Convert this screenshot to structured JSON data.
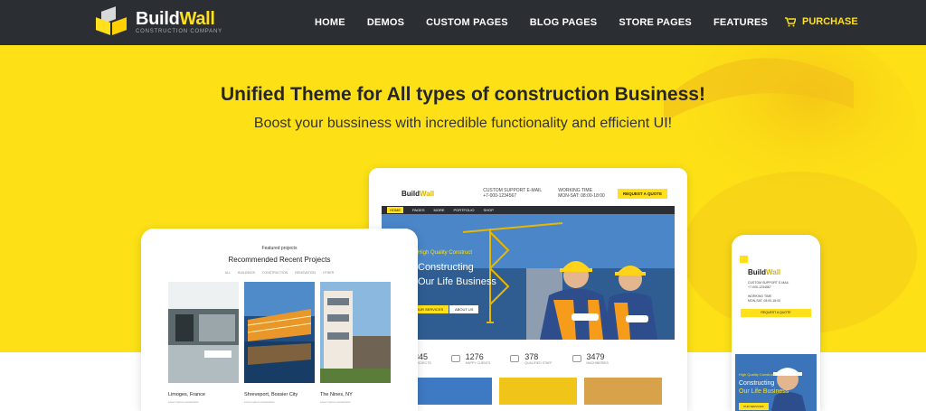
{
  "nav": {
    "logo_part1": "Build",
    "logo_part2": "Wall",
    "logo_sub": "CONSTRUCTION COMPANY",
    "items": [
      "HOME",
      "DEMOS",
      "CUSTOM PAGES",
      "BLOG PAGES",
      "STORE PAGES",
      "FEATURES"
    ],
    "purchase": "PURCHASE"
  },
  "hero": {
    "headline": "Unified Theme for All types of construction Business!",
    "subline": "Boost your bussiness with incredible functionality and efficient UI!"
  },
  "laptop": {
    "logo_part1": "Build",
    "logo_part2": "Wall",
    "phone_label": "CUSTOM SUPPORT E-MAIL",
    "phone": "+7-000-1234567",
    "hours_label": "WORKING TIME",
    "hours": "MON-SAT: 08:00-18:00",
    "quote_btn": "REQUEST A QUOTE",
    "menu": [
      "HOME",
      "PAGES",
      "MORE",
      "PORTFOLIO",
      "SHOP"
    ],
    "tag": "High Quality Construct",
    "title1a": "Constructing",
    "title2a": "Our Life Business",
    "btn1": "OUR SERVICES",
    "btn2": "ABOUT US",
    "stats": [
      {
        "num": "345",
        "label": "PROJECTS"
      },
      {
        "num": "1276",
        "label": "HAPPY CLIENTS"
      },
      {
        "num": "378",
        "label": "QUALIFIED STAFF"
      },
      {
        "num": "3479",
        "label": "MACHINERIES"
      }
    ]
  },
  "tablet": {
    "small": "Featured projects",
    "title": "Recommended Recent Projects",
    "filters": [
      "ALL",
      "BUILDINGS",
      "CONSTRUCTION",
      "RENOVATION",
      "OTHER"
    ],
    "cards": [
      {
        "name": "Limoges, France",
        "meta": "Lorem ipsum consectetur"
      },
      {
        "name": "Shreveport, Bossier City",
        "meta": "Lorem ipsum consectetur"
      },
      {
        "name": "The Nines, NY",
        "meta": "Lorem ipsum consectetur"
      }
    ]
  },
  "phone": {
    "logo_part1": "Build",
    "logo_part2": "Wall",
    "phone_label": "CUSTOM SUPPORT E-MAIL",
    "phone": "+7-000-1234567",
    "hours_label": "WORKING TIME",
    "hours": "MON-SAT: 08:00-18:00",
    "btn": "REQUEST A QUOTE",
    "tag": "High Quality Construct",
    "title1": "Constructing",
    "title2": "Our Life Business",
    "cta": "OUR SERVICES"
  },
  "colors": {
    "brand_yellow": "#fde116",
    "nav_dark": "#2b2e33"
  }
}
